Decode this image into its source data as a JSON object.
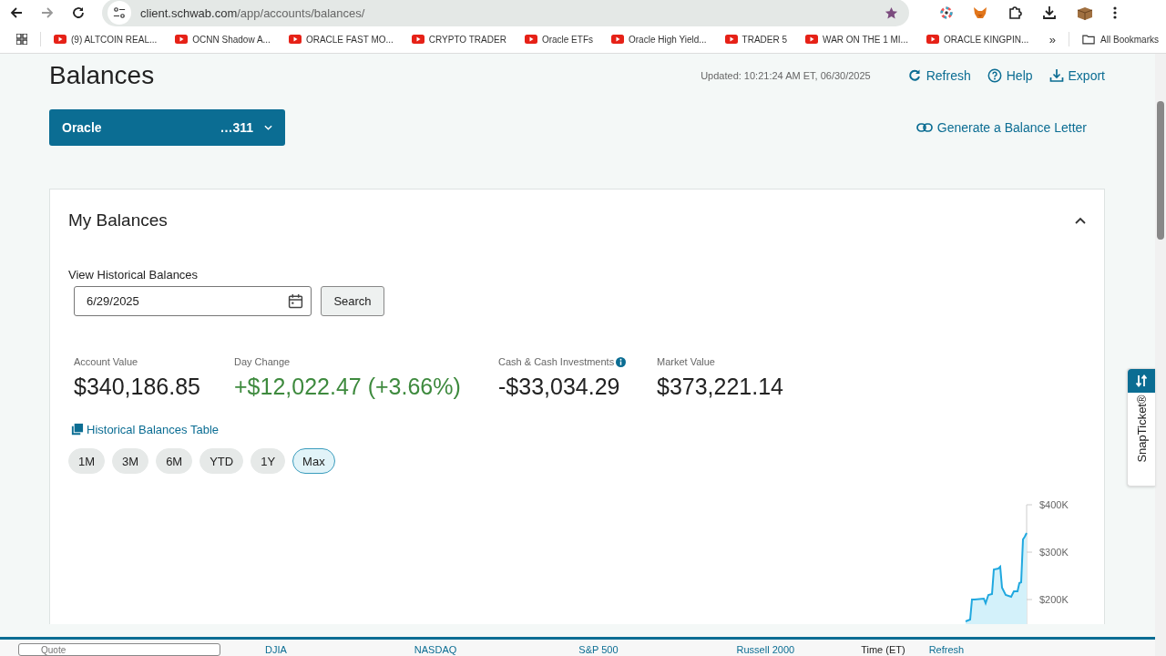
{
  "browser": {
    "url_host": "client.schwab.com",
    "url_path": "/app/accounts/balances/",
    "bookmarks": [
      "(9) ALTCOIN REAL...",
      "OCNN  Shadow A...",
      "ORACLE FAST MO...",
      "CRYPTO TRADER",
      "Oracle ETFs",
      "Oracle High Yield...",
      "TRADER 5",
      "WAR ON THE 1 MI...",
      "ORACLE KINGPIN..."
    ],
    "overflow": "»",
    "all_bookmarks": "All Bookmarks"
  },
  "page": {
    "title": "Balances",
    "updated": "Updated: 10:21:24 AM ET, 06/30/2025",
    "actions": [
      {
        "label": "Refresh",
        "kind": "refresh"
      },
      {
        "label": "Help",
        "kind": "help"
      },
      {
        "label": "Export",
        "kind": "export"
      }
    ],
    "account": {
      "name": "Oracle",
      "number": "…311"
    },
    "balance_letter": "Generate a Balance Letter"
  },
  "card": {
    "title": "My Balances",
    "expanded": true,
    "history_label": "View Historical Balances",
    "date": "6/29/2025",
    "search": "Search",
    "metrics": [
      {
        "label": "Account Value",
        "value": "$340,186.85",
        "kind": "neutral",
        "info": false
      },
      {
        "label": "Day Change",
        "value": "+$12,022.47 (+3.66%)",
        "kind": "gain",
        "info": false
      },
      {
        "label": "Cash & Cash Investments",
        "value": "-$33,034.29",
        "kind": "neutral",
        "info": true
      },
      {
        "label": "Market Value",
        "value": "$373,221.14",
        "kind": "neutral",
        "info": false
      }
    ],
    "table_link": "Historical Balances Table",
    "ranges": [
      {
        "label": "1M",
        "selected": false
      },
      {
        "label": "3M",
        "selected": false
      },
      {
        "label": "6M",
        "selected": false
      },
      {
        "label": "YTD",
        "selected": false
      },
      {
        "label": "1Y",
        "selected": false
      },
      {
        "label": "Max",
        "selected": true
      }
    ],
    "axis_labels": [
      "$400K",
      "$300K",
      "$200K"
    ]
  },
  "snap_ticket": "SnapTicket®",
  "ticker": {
    "quote_placeholder": "Quote",
    "indices": [
      "DJIA",
      "NASDAQ",
      "S&P 500",
      "Russell 2000"
    ],
    "time": "Time (ET)",
    "refresh": "Refresh"
  }
}
